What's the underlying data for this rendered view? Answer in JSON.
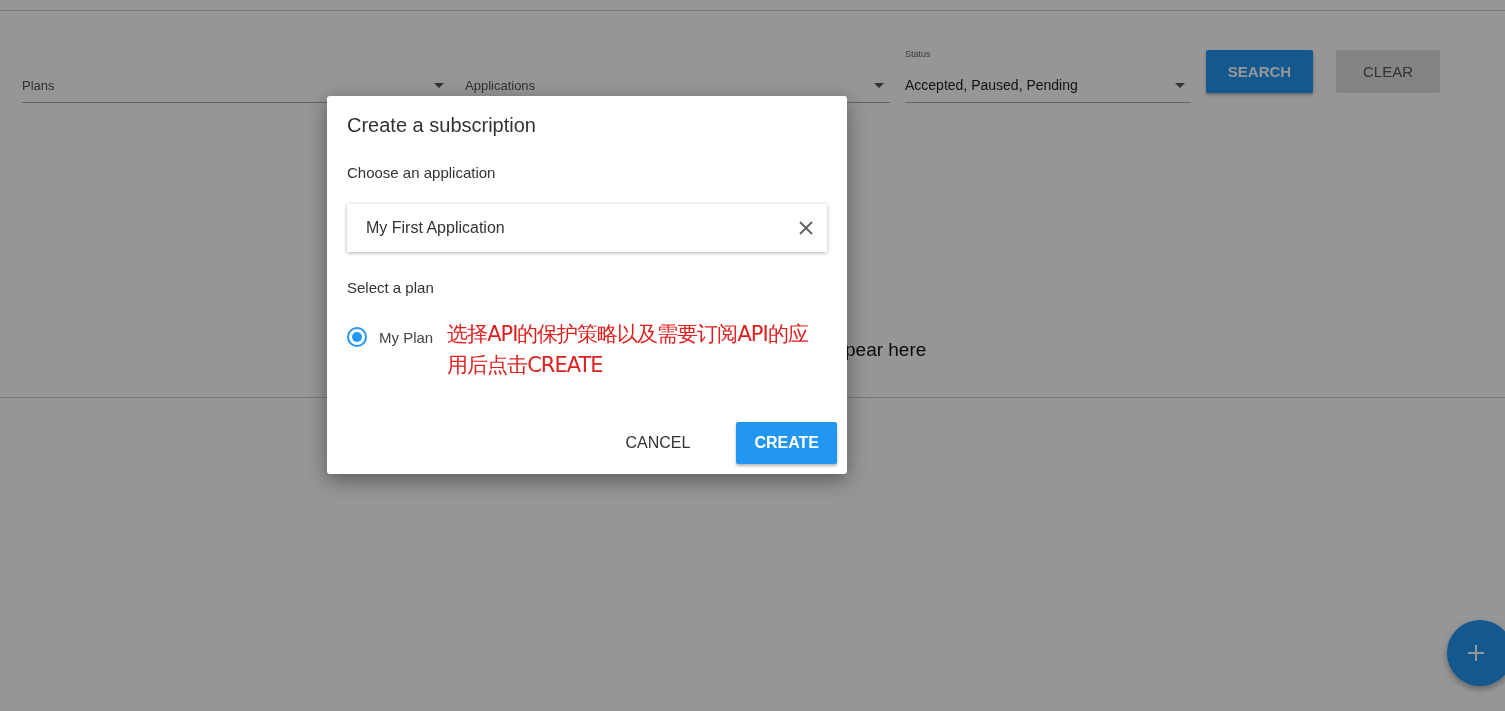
{
  "filters": [
    {
      "label": "Plans"
    },
    {
      "label": "Applications"
    },
    {
      "label": "Status",
      "value": "Accepted, Paused, Pending"
    }
  ],
  "buttons": [
    {
      "label": "SEARCH",
      "kind": "primary",
      "disabled": false
    },
    {
      "label": "CLEAR",
      "kind": "secondary",
      "disabled": true
    }
  ],
  "empty_message": "pear here",
  "dialog": {
    "title": "Create a subscription",
    "application_label": "Choose an application",
    "application_value": "My First Application",
    "plan_label": "Select a plan",
    "plans": [
      {
        "label": "My Plan",
        "selected": true
      }
    ],
    "annotation": "选择API的保护策略以及需要订阅API的应用后点击CREATE",
    "actions": [
      {
        "label": "CANCEL",
        "kind": "text"
      },
      {
        "label": "CREATE",
        "kind": "primary"
      }
    ]
  }
}
